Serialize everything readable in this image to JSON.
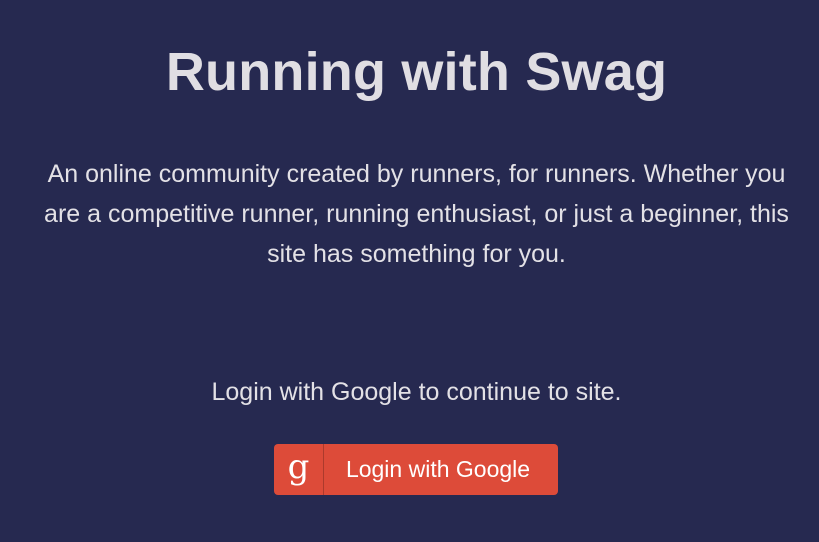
{
  "header": {
    "title": "Running with Swag"
  },
  "intro": {
    "tagline": "An online community created by runners, for runners. Whether you are a competitive runner, running enthusiast, or just a beginner, this site has something for you."
  },
  "login": {
    "prompt": "Login with Google to continue to site.",
    "button_label": "Login with Google",
    "button_icon": "google-g-icon",
    "button_icon_glyph": "g",
    "button_color": "#dd4b39"
  },
  "colors": {
    "background": "#262950",
    "text": "#e3e1e6"
  }
}
